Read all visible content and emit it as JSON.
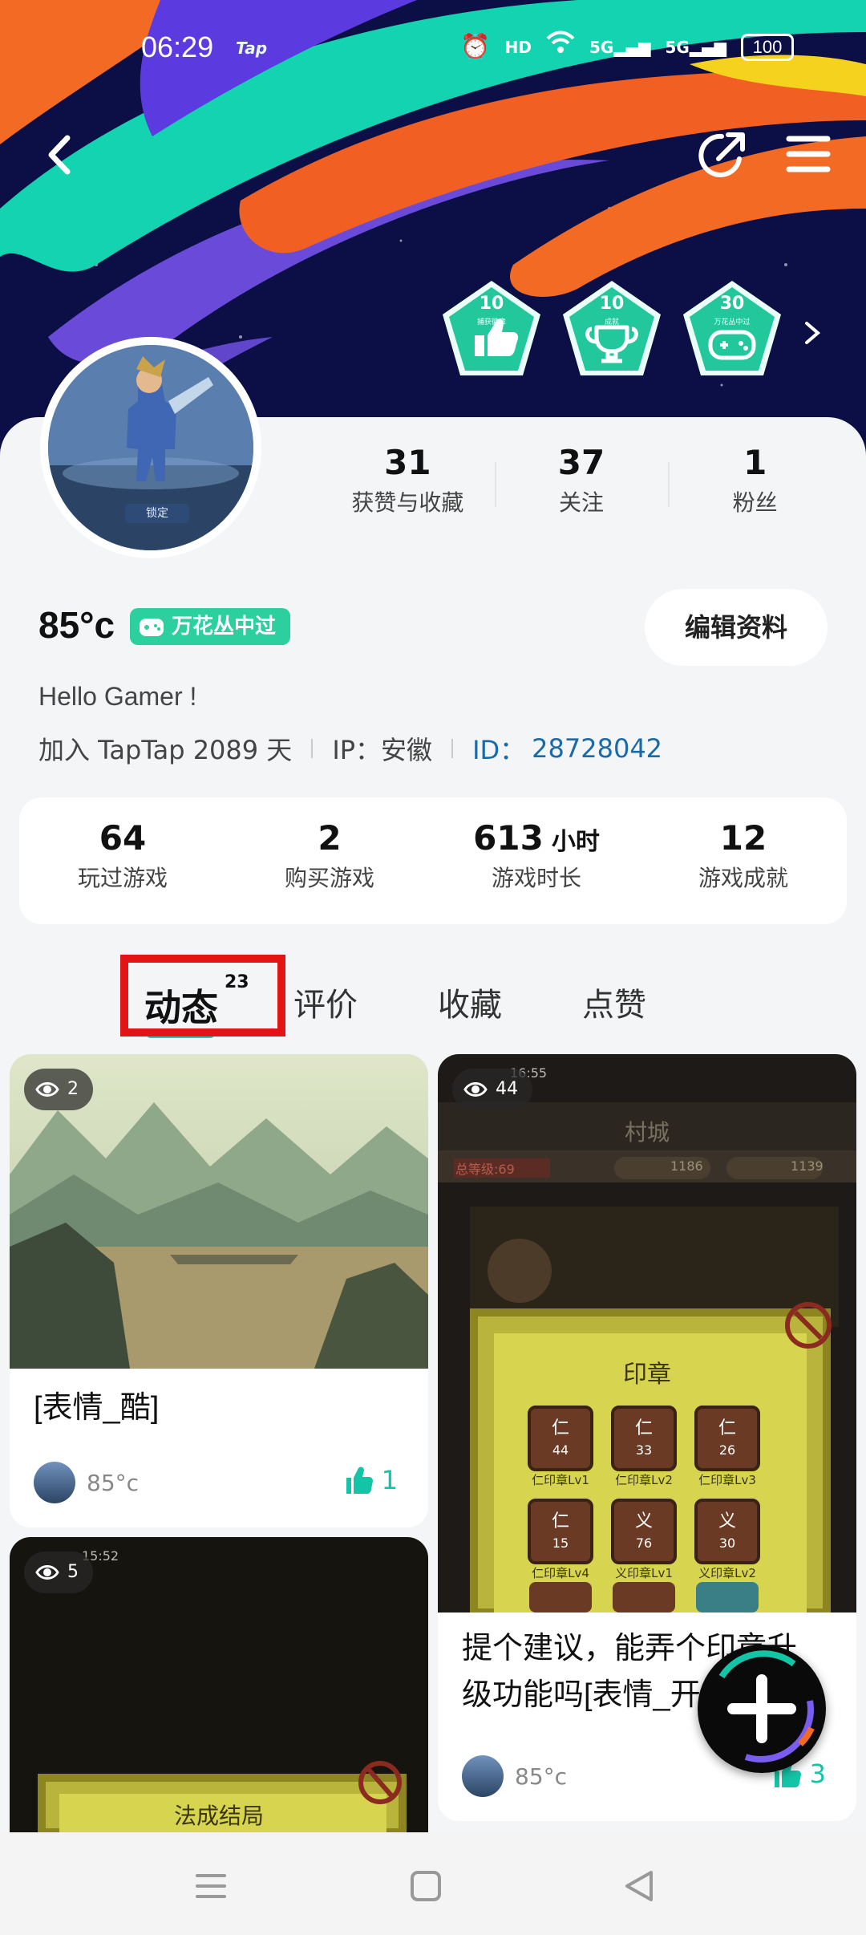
{
  "status_bar": {
    "time": "06:29",
    "app_mark": "Tap",
    "icons": [
      "alarm-icon",
      "hd-icon",
      "wifi-icon",
      "5g-signal-icon",
      "5g-signal-icon"
    ],
    "hd_label": "HD",
    "signal_label": "5G",
    "battery": "100"
  },
  "header": {
    "back_icon": "back-chevron-icon",
    "share_icon": "share-icon",
    "menu_icon": "menu-icon",
    "badges": [
      {
        "value": "10",
        "caption": "捕获徽章",
        "icon": "thumbs-up-icon"
      },
      {
        "value": "10",
        "caption": "成就",
        "icon": "trophy-icon"
      },
      {
        "value": "30",
        "caption": "万花丛中过",
        "icon": "gamepad-icon"
      }
    ],
    "badges_more_icon": "chevron-right-icon"
  },
  "profile": {
    "avatar_caption": "",
    "avatar_tag": "锁定",
    "stats": [
      {
        "value": "31",
        "label": "获赞与收藏"
      },
      {
        "value": "37",
        "label": "关注"
      },
      {
        "value": "1",
        "label": "粉丝"
      }
    ],
    "username": "85°c",
    "title_badge": "万花丛中过",
    "edit_button": "编辑资料",
    "bio": "Hello Gamer !",
    "join_text": "加入 TapTap 2089 天",
    "ip_text": "IP：安徽",
    "id_label": "ID：",
    "id_value": "28728042"
  },
  "game_stats": [
    {
      "value": "64",
      "unit": "",
      "label": "玩过游戏"
    },
    {
      "value": "2",
      "unit": "",
      "label": "购买游戏"
    },
    {
      "value": "613",
      "unit": "小时",
      "label": "游戏时长"
    },
    {
      "value": "12",
      "unit": "",
      "label": "游戏成就"
    }
  ],
  "tabs": [
    {
      "label": "动态",
      "count": "23",
      "active": true
    },
    {
      "label": "评价"
    },
    {
      "label": "收藏"
    },
    {
      "label": "点赞"
    }
  ],
  "feed": [
    {
      "views": "2",
      "title": "[表情_酷]",
      "author": "85°c",
      "likes": "1"
    },
    {
      "views": "44",
      "title_line1": "提个建议，能弄个印章升",
      "title_line2": "级功能吗[表情_开",
      "author": "85°c",
      "likes": "3",
      "shot": {
        "time": "16:55",
        "header": "村城",
        "level": "总等级:69",
        "coins": "1186",
        "gems": "1139",
        "panel_title": "印章",
        "seals": [
          {
            "glyph": "仁",
            "n": "44",
            "label": "仁印章Lv1"
          },
          {
            "glyph": "仁",
            "n": "33",
            "label": "仁印章Lv2"
          },
          {
            "glyph": "仁",
            "n": "26",
            "label": "仁印章Lv3"
          },
          {
            "glyph": "仁",
            "n": "15",
            "label": "仁印章Lv4"
          },
          {
            "glyph": "义",
            "n": "76",
            "label": "义印章Lv1"
          },
          {
            "glyph": "义",
            "n": "30",
            "label": "义印章Lv2"
          }
        ]
      }
    },
    {
      "views": "5",
      "shot": {
        "time": "15:52",
        "panel_title": "法成结局"
      }
    }
  ],
  "fab_icon": "plus-icon",
  "nav": [
    "menu-nav-icon",
    "home-nav-icon",
    "back-nav-icon"
  ]
}
